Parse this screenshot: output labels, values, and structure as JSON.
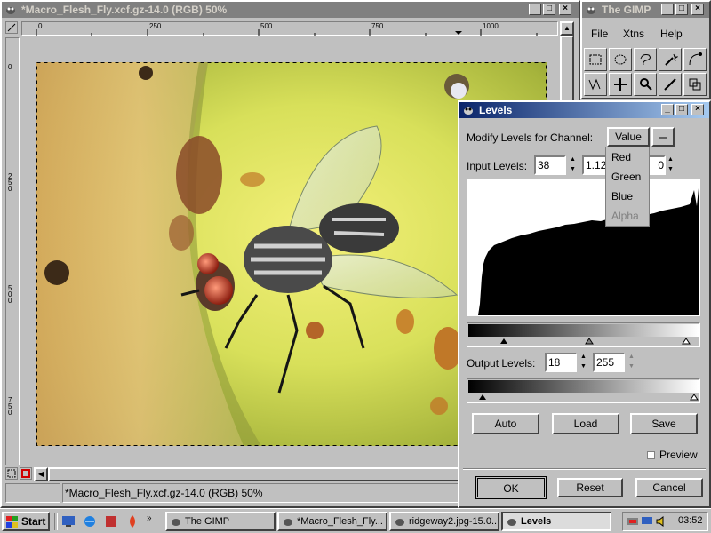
{
  "image_window": {
    "title": "*Macro_Flesh_Fly.xcf.gz-14.0 (RGB) 50%",
    "ruler_top_ticks": [
      "0",
      "250",
      "500",
      "750",
      "1000"
    ],
    "ruler_left_ticks": [
      "0",
      "250",
      "500",
      "750"
    ],
    "status_text": "*Macro_Flesh_Fly.xcf.gz-14.0 (RGB) 50%"
  },
  "gimp_toolbox": {
    "title": "The GIMP",
    "menu": [
      "File",
      "Xtns",
      "Help"
    ],
    "tool_icons": [
      "rect-select-icon",
      "ellipse-select-icon",
      "lasso-icon",
      "fuzzy-select-icon",
      "bezier-icon",
      "paths-icon",
      "move-icon",
      "zoom-icon",
      "crop-icon",
      "transform-icon"
    ]
  },
  "levels_dialog": {
    "title": "Levels",
    "channel_label": "Modify Levels for Channel:",
    "channel_selected": "Value",
    "channel_options": [
      "Red",
      "Green",
      "Blue",
      "Alpha"
    ],
    "input_label": "Input Levels:",
    "input_low": "38",
    "input_gamma": "1.12",
    "input_high": "0",
    "output_label": "Output Levels:",
    "output_low": "18",
    "output_high": "255",
    "auto_label": "Auto",
    "load_label": "Load",
    "save_label": "Save",
    "preview_label": "Preview",
    "ok_label": "OK",
    "reset_label": "Reset",
    "cancel_label": "Cancel"
  },
  "taskbar": {
    "start_label": "Start",
    "tasks": [
      {
        "label": "The GIMP"
      },
      {
        "label": "*Macro_Flesh_Fly..."
      },
      {
        "label": "ridgeway2.jpg-15.0..."
      },
      {
        "label": "Levels"
      }
    ],
    "clock": "03:52"
  },
  "colors": {
    "titlebar_active": "#0a246a",
    "titlebar_inactive": "#808080",
    "desktop": "#c0c0c0"
  }
}
